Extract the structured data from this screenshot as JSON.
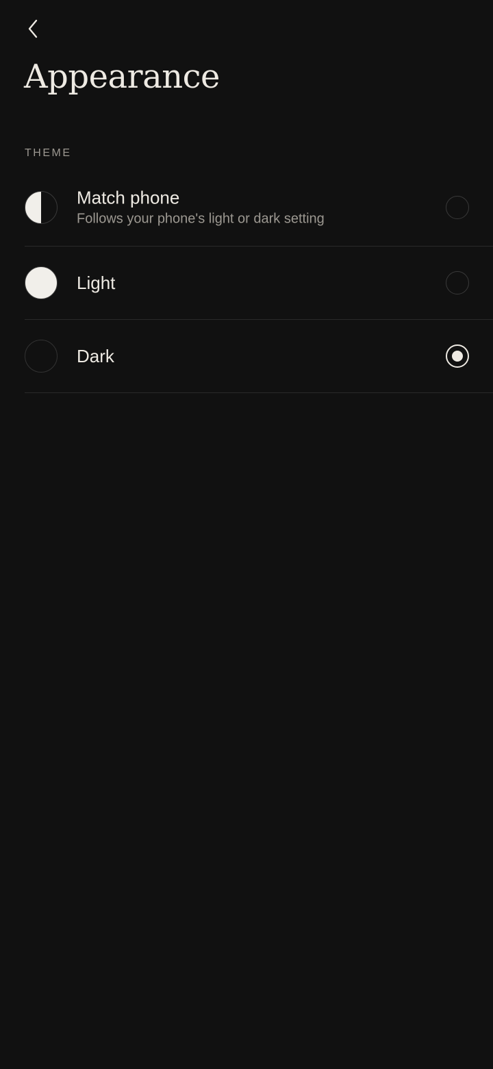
{
  "header": {
    "back_icon": "chevron-left-icon",
    "title": "Appearance"
  },
  "theme_section": {
    "label": "THEME",
    "options": [
      {
        "title": "Match phone",
        "subtitle": "Follows your phone's light or dark setting",
        "icon": "half-circle-icon",
        "selected": false
      },
      {
        "title": "Light",
        "icon": "light-circle-icon",
        "selected": false
      },
      {
        "title": "Dark",
        "icon": "dark-circle-icon",
        "selected": true
      }
    ]
  },
  "colors": {
    "background": "#111111",
    "text_primary": "#EEEAE3",
    "text_secondary": "#9C9891",
    "divider": "#2A2A2A"
  }
}
